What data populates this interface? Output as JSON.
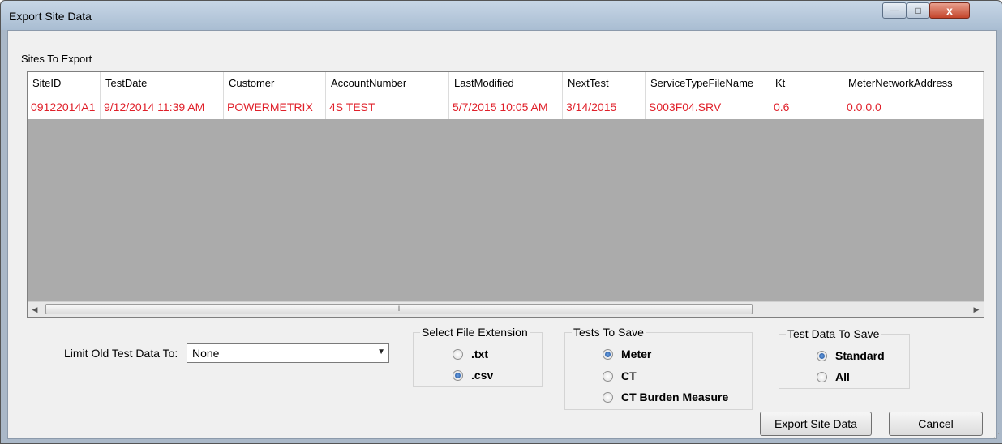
{
  "window": {
    "title": "Export Site Data",
    "controls": {
      "minimize": "—",
      "maximize": "□",
      "close": "x"
    }
  },
  "sites_panel": {
    "label": "Sites To Export",
    "columns": [
      "SiteID",
      "TestDate",
      "Customer",
      "AccountNumber",
      "LastModified",
      "NextTest",
      "ServiceTypeFileName",
      "Kt",
      "MeterNetworkAddress"
    ],
    "rows": [
      [
        "09122014A1",
        "9/12/2014 11:39 AM",
        "POWERMETRIX",
        "4S TEST",
        "5/7/2015 10:05 AM",
        "3/14/2015",
        "S003F04.SRV",
        "0.6",
        "0.0.0.0"
      ]
    ],
    "row_text_color": "#e0202a",
    "scroll_thumb_glyph": "III"
  },
  "limit": {
    "label": "Limit Old Test Data To:",
    "value": "None"
  },
  "file_extension": {
    "title": "Select File Extension",
    "options": [
      {
        "label": ".txt",
        "selected": false
      },
      {
        "label": ".csv",
        "selected": true
      }
    ]
  },
  "tests_to_save": {
    "title": "Tests To Save",
    "options": [
      {
        "label": "Meter",
        "selected": true
      },
      {
        "label": "CT",
        "selected": false
      },
      {
        "label": "CT Burden Measure",
        "selected": false
      }
    ]
  },
  "test_data_to_save": {
    "title": "Test Data To Save",
    "options": [
      {
        "label": "Standard",
        "selected": true
      },
      {
        "label": "All",
        "selected": false
      }
    ]
  },
  "buttons": {
    "export": "Export Site Data",
    "cancel": "Cancel"
  }
}
